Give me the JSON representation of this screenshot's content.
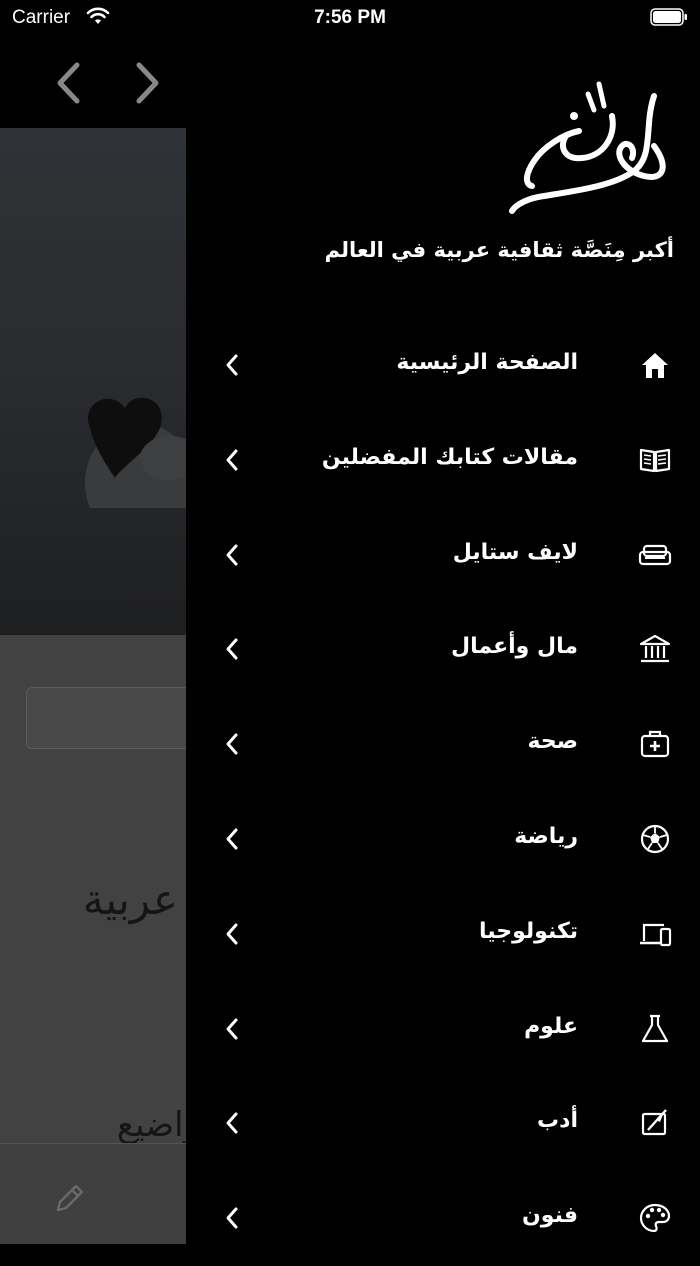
{
  "status_bar": {
    "carrier": "Carrier",
    "time": "7:56 PM"
  },
  "background": {
    "heading_fragment": "عربية",
    "sub_fragment": "واضيع"
  },
  "drawer": {
    "logo_text": "جوك",
    "tagline": "أكبر مِنَصَّة ثقافية عربية في العالم",
    "menu": [
      {
        "label": "الصفحة الرئيسية",
        "icon": "home-icon"
      },
      {
        "label": "مقالات كتابك المفضلين",
        "icon": "book-icon"
      },
      {
        "label": "لايف ستايل",
        "icon": "sofa-icon"
      },
      {
        "label": "مال وأعمال",
        "icon": "bank-icon"
      },
      {
        "label": "صحة",
        "icon": "first-aid-icon"
      },
      {
        "label": "رياضة",
        "icon": "soccer-ball-icon"
      },
      {
        "label": "تكنولوجيا",
        "icon": "devices-icon"
      },
      {
        "label": "علوم",
        "icon": "flask-icon"
      },
      {
        "label": "أدب",
        "icon": "feather-book-icon"
      },
      {
        "label": "فنون",
        "icon": "palette-icon"
      }
    ]
  },
  "colors": {
    "drawer_bg": "#000000",
    "text": "#ffffff",
    "overlay": "#424242"
  }
}
